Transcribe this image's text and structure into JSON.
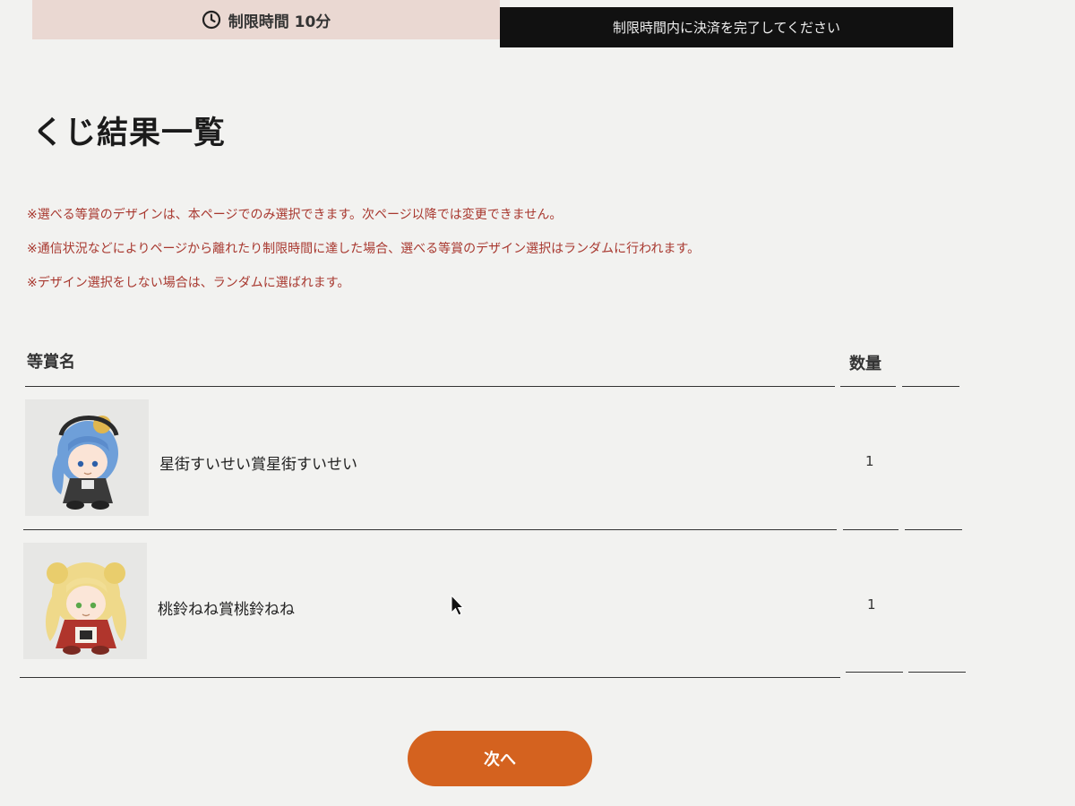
{
  "header": {
    "timer_label": "制限時間 10分",
    "notice": "制限時間内に決済を完了してください"
  },
  "page_title": "くじ結果一覧",
  "notes": [
    "※選べる等賞のデザインは、本ページでのみ選択できます。次ページ以降では変更できません。",
    "※通信状況などによりページから離れたり制限時間に達した場合、選べる等賞のデザイン選択はランダムに行われます。",
    "※デザイン選択をしない場合は、ランダムに選ばれます。"
  ],
  "table": {
    "headers": {
      "name": "等賞名",
      "quantity": "数量"
    },
    "rows": [
      {
        "name": "星街すいせい賞星街すいせい",
        "quantity": "1",
        "hair_color": "#6e9fd9"
      },
      {
        "name": "桃鈴ねね賞桃鈴ねね",
        "quantity": "1",
        "hair_color": "#efd98a"
      }
    ]
  },
  "next_button": {
    "label": "次へ",
    "color": "#d4621f"
  },
  "icons": {
    "timer": "clock-icon",
    "pointer": "mouse-cursor-icon"
  }
}
